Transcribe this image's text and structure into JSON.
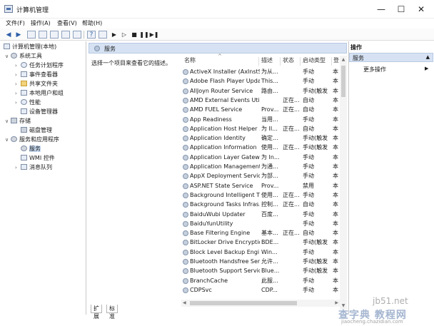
{
  "window": {
    "title": "计算机管理",
    "controls": {
      "minimize": "—",
      "maximize": "☐",
      "close": "✕"
    }
  },
  "menu": [
    "文件(F)",
    "操作(A)",
    "查看(V)",
    "帮助(H)"
  ],
  "toolbar": {
    "buttons": [
      "back-arrow",
      "forward-arrow",
      "folder",
      "console-tree",
      "properties",
      "refresh",
      "export",
      "help",
      "console",
      "play",
      "play-next",
      "stop",
      "pause",
      "restart"
    ]
  },
  "tree": [
    {
      "label": "计算机管理(本地)",
      "level": 0,
      "toggle": "",
      "icon": "computer"
    },
    {
      "label": "系统工具",
      "level": 1,
      "toggle": "∨",
      "icon": "gear"
    },
    {
      "label": "任务计划程序",
      "level": 2,
      "toggle": "›",
      "icon": "clock"
    },
    {
      "label": "事件查看器",
      "level": 2,
      "toggle": "›",
      "icon": "log"
    },
    {
      "label": "共享文件夹",
      "level": 2,
      "toggle": "›",
      "icon": "folder"
    },
    {
      "label": "本地用户和组",
      "level": 2,
      "toggle": "›",
      "icon": "users"
    },
    {
      "label": "性能",
      "level": 2,
      "toggle": "›",
      "icon": "gauge"
    },
    {
      "label": "设备管理器",
      "level": 2,
      "toggle": "",
      "icon": "device"
    },
    {
      "label": "存储",
      "level": 1,
      "toggle": "∨",
      "icon": "disk"
    },
    {
      "label": "磁盘管理",
      "level": 2,
      "toggle": "",
      "icon": "disk"
    },
    {
      "label": "服务和应用程序",
      "level": 1,
      "toggle": "∨",
      "icon": "gear"
    },
    {
      "label": "服务",
      "level": 2,
      "toggle": "",
      "icon": "gear",
      "selected": true
    },
    {
      "label": "WMI 控件",
      "level": 2,
      "toggle": "",
      "icon": "wmi"
    },
    {
      "label": "消息队列",
      "level": 2,
      "toggle": "›",
      "icon": "queue"
    }
  ],
  "services_panel": {
    "header": "服务",
    "description": "选择一个项目来查看它的描述。",
    "columns": [
      "名称",
      "描述",
      "状态",
      "启动类型",
      "登"
    ],
    "rows": [
      {
        "name": "ActiveX Installer (AxInstSV)",
        "desc": "为从...",
        "status": "",
        "startup": "手动",
        "logon": "本"
      },
      {
        "name": "Adobe Flash Player Upda...",
        "desc": "This...",
        "status": "",
        "startup": "手动",
        "logon": "本"
      },
      {
        "name": "AllJoyn Router Service",
        "desc": "路由...",
        "status": "",
        "startup": "手动(触发...",
        "logon": "本"
      },
      {
        "name": "AMD External Events Utility",
        "desc": "",
        "status": "正在...",
        "startup": "自动",
        "logon": "本"
      },
      {
        "name": "AMD FUEL Service",
        "desc": "Prov...",
        "status": "正在...",
        "startup": "自动",
        "logon": "本"
      },
      {
        "name": "App Readiness",
        "desc": "当用...",
        "status": "",
        "startup": "手动",
        "logon": "本"
      },
      {
        "name": "Application Host Helper ...",
        "desc": "为 II...",
        "status": "正在...",
        "startup": "自动",
        "logon": "本"
      },
      {
        "name": "Application Identity",
        "desc": "确定...",
        "status": "",
        "startup": "手动(触发...",
        "logon": "本"
      },
      {
        "name": "Application Information",
        "desc": "使用...",
        "status": "正在...",
        "startup": "手动(触发...",
        "logon": "本"
      },
      {
        "name": "Application Layer Gatewa...",
        "desc": "为 In...",
        "status": "",
        "startup": "手动",
        "logon": "本"
      },
      {
        "name": "Application Management",
        "desc": "为通...",
        "status": "",
        "startup": "手动",
        "logon": "本"
      },
      {
        "name": "AppX Deployment Servic...",
        "desc": "为部...",
        "status": "",
        "startup": "手动",
        "logon": "本"
      },
      {
        "name": "ASP.NET State Service",
        "desc": "Prov...",
        "status": "",
        "startup": "禁用",
        "logon": "本"
      },
      {
        "name": "Background Intelligent T...",
        "desc": "使用...",
        "status": "正在...",
        "startup": "手动",
        "logon": "本"
      },
      {
        "name": "Background Tasks Infras...",
        "desc": "控制...",
        "status": "正在...",
        "startup": "自动",
        "logon": "本"
      },
      {
        "name": "BaiduWubi Updater",
        "desc": "百度...",
        "status": "",
        "startup": "手动",
        "logon": "本"
      },
      {
        "name": "BaiduYunUtility",
        "desc": "",
        "status": "",
        "startup": "手动",
        "logon": "本"
      },
      {
        "name": "Base Filtering Engine",
        "desc": "基本...",
        "status": "正在...",
        "startup": "自动",
        "logon": "本"
      },
      {
        "name": "BitLocker Drive Encryptio...",
        "desc": "BDE...",
        "status": "",
        "startup": "手动(触发...",
        "logon": "本"
      },
      {
        "name": "Block Level Backup Engi...",
        "desc": "Win...",
        "status": "",
        "startup": "手动",
        "logon": "本"
      },
      {
        "name": "Bluetooth Handsfree Ser...",
        "desc": "允许...",
        "status": "",
        "startup": "手动(触发...",
        "logon": "本"
      },
      {
        "name": "Bluetooth Support Service",
        "desc": "Blue...",
        "status": "",
        "startup": "手动(触发...",
        "logon": "本"
      },
      {
        "name": "BranchCache",
        "desc": "此服...",
        "status": "",
        "startup": "手动",
        "logon": "本"
      },
      {
        "name": "CDPSvc",
        "desc": "CDP...",
        "status": "",
        "startup": "手动",
        "logon": "本"
      }
    ]
  },
  "tabs": [
    "扩展",
    "标准"
  ],
  "actions": {
    "title": "操作",
    "section": "服务",
    "section_arrow": "▲",
    "more": "更多操作",
    "more_arrow": "▶"
  },
  "watermark": {
    "line1": "jb51.net",
    "line2": "查字典 教程网",
    "line3": "jiaocheng.chazidian.com"
  }
}
